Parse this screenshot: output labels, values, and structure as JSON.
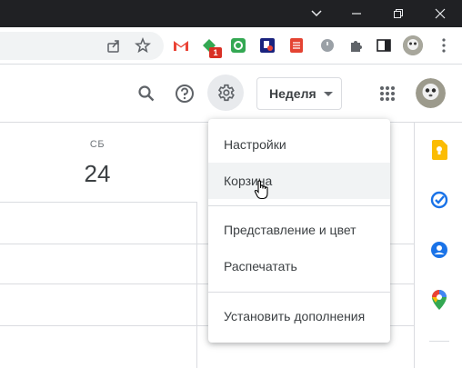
{
  "header": {
    "view_selector": "Неделя"
  },
  "calendar": {
    "day_name": "СБ",
    "day_number": "24"
  },
  "menu": {
    "items": [
      {
        "label": "Настройки"
      },
      {
        "label": "Корзина"
      },
      {
        "label": "Представление и цвет"
      },
      {
        "label": "Распечатать"
      },
      {
        "label": "Установить дополнения"
      }
    ]
  },
  "extensions": {
    "badge_count": "1"
  },
  "colors": {
    "keep": "#fbbc04",
    "tasks": "#1a73e8",
    "contacts": "#1a73e8",
    "chrome_titlebar": "#202124"
  },
  "icons": [
    "minimize-icon",
    "restore-icon",
    "close-icon",
    "share-icon",
    "star-icon",
    "gmail-icon",
    "extension-icon",
    "puzzle-icon",
    "sidepanel-icon",
    "more-vert-icon",
    "search-icon",
    "help-icon",
    "settings-icon",
    "apps-grid-icon",
    "avatar",
    "keep-icon",
    "tasks-icon",
    "contacts-icon",
    "maps-icon"
  ]
}
